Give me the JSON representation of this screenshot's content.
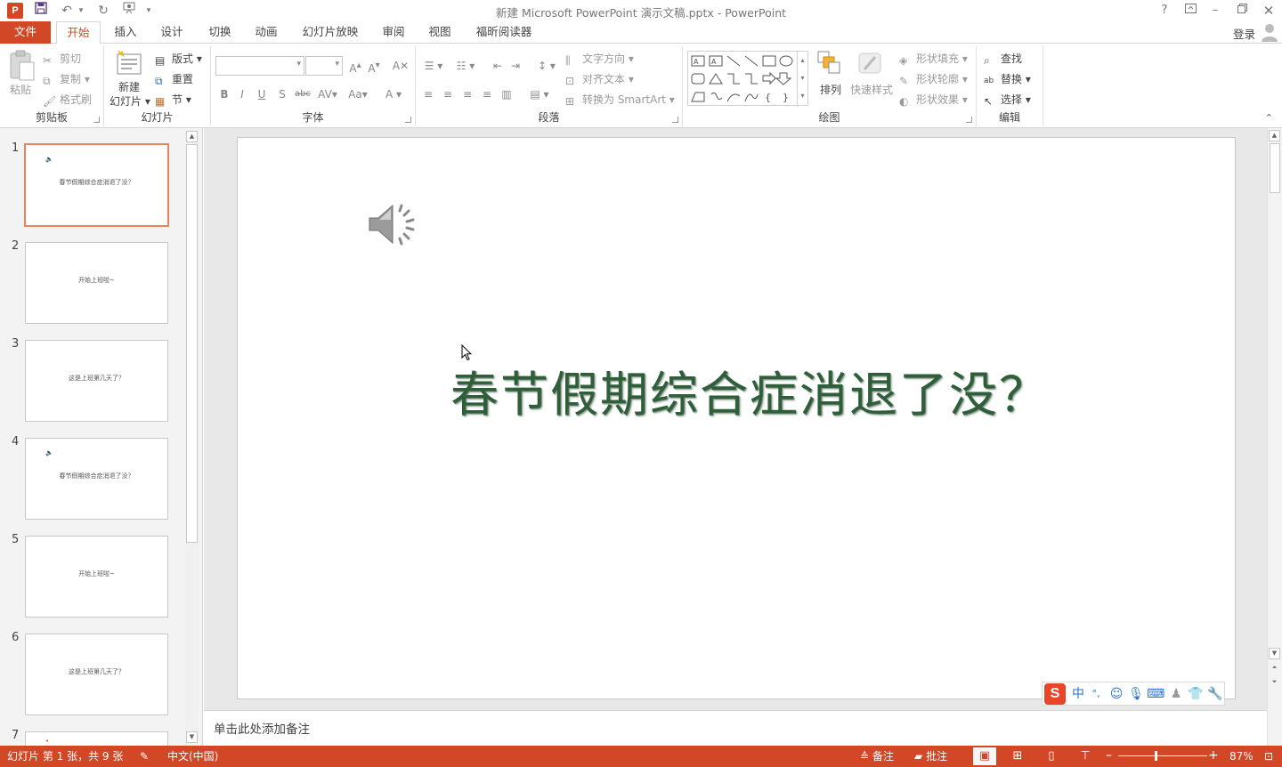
{
  "window": {
    "title": "新建 Microsoft PowerPoint 演示文稿.pptx - PowerPoint",
    "app_logo": "P",
    "help": "?",
    "controls": [
      "restore-ribbon-icon",
      "minimize-icon",
      "maximize-icon",
      "close-icon"
    ]
  },
  "tabs": {
    "file": "文件",
    "items": [
      "开始",
      "插入",
      "设计",
      "切换",
      "动画",
      "幻灯片放映",
      "审阅",
      "视图",
      "福昕阅读器"
    ],
    "active_index": 0,
    "login": "登录"
  },
  "ribbon": {
    "clipboard": {
      "label": "剪贴板",
      "paste": "粘贴",
      "cut": "剪切",
      "copy": "复制",
      "format_painter": "格式刷"
    },
    "slides": {
      "label": "幻灯片",
      "new_slide_1": "新建",
      "new_slide_2": "幻灯片",
      "layout": "版式",
      "reset": "重置",
      "section": "节"
    },
    "font": {
      "label": "字体",
      "font_name": "",
      "font_size": "",
      "bold": "B",
      "italic": "I",
      "underline": "U",
      "shadow": "S",
      "strike": "abc",
      "spacing": "AV",
      "case": "Aa",
      "color": "A"
    },
    "paragraph": {
      "label": "段落",
      "text_direction": "文字方向",
      "align_text": "对齐文本",
      "smartart": "转换为 SmartArt"
    },
    "drawing": {
      "label": "绘图",
      "arrange": "排列",
      "quick_styles": "快速样式",
      "shape_fill": "形状填充",
      "shape_outline": "形状轮廓",
      "shape_effects": "形状效果"
    },
    "editing": {
      "label": "编辑",
      "find": "查找",
      "replace": "替换",
      "select": "选择"
    }
  },
  "slides": [
    {
      "num": "1",
      "text": "春节假期综合症消退了没？",
      "has_audio": true
    },
    {
      "num": "2",
      "text": "开始上班啦~",
      "has_audio": false
    },
    {
      "num": "3",
      "text": "这是上班第几天了？",
      "has_audio": false
    },
    {
      "num": "4",
      "text": "春节假期综合症消退了没？",
      "has_audio": true
    },
    {
      "num": "5",
      "text": "开始上班啦~",
      "has_audio": false
    },
    {
      "num": "6",
      "text": "这是上班第几天了？",
      "has_audio": false
    },
    {
      "num": "7",
      "text": "",
      "has_audio": true
    }
  ],
  "current_slide": {
    "title": "春节假期综合症消退了没？",
    "has_audio_icon": true
  },
  "notes": {
    "placeholder": "单击此处添加备注"
  },
  "ime": {
    "logo": "S",
    "mode": "中",
    "punct": "°,"
  },
  "statusbar": {
    "slide_info": "幻灯片 第 1 张，共 9 张",
    "language": "中文(中国)",
    "notes": "备注",
    "comments": "批注",
    "zoom": "87%"
  },
  "colors": {
    "accent": "#d24726",
    "title_text": "#2e5e3a",
    "active_thumb_border": "#e9825e"
  }
}
